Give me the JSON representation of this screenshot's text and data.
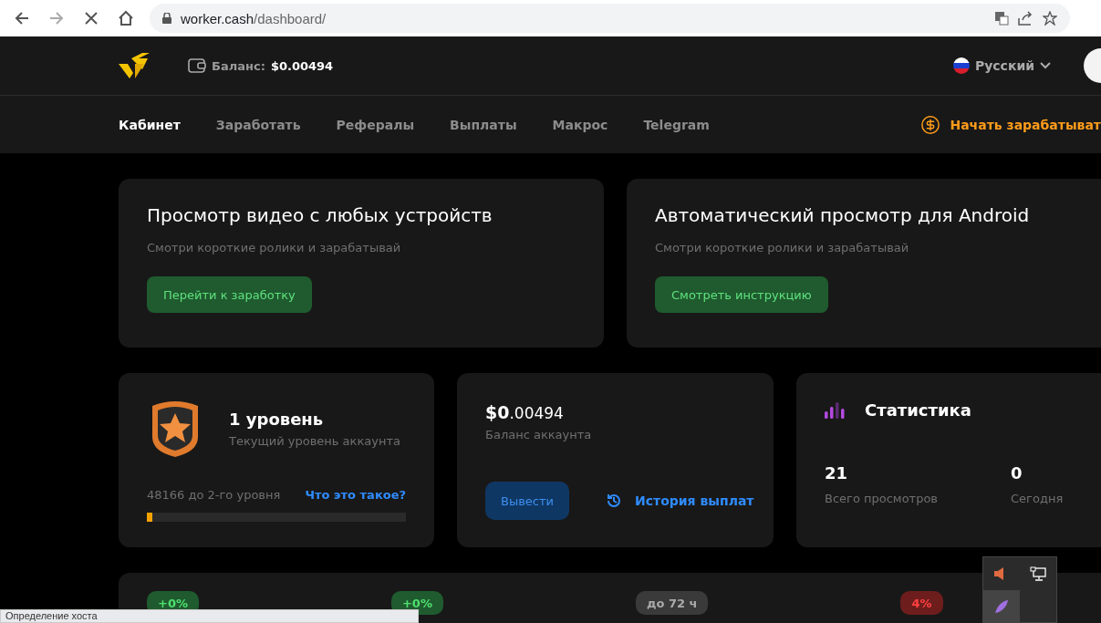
{
  "browser": {
    "url_host": "worker.cash",
    "url_path": "/dashboard/"
  },
  "header": {
    "balance_label": "Баланс:",
    "balance_value": "$0.00494",
    "language": "Русский"
  },
  "nav": {
    "items": [
      {
        "label": "Кабинет",
        "selected": true
      },
      {
        "label": "Заработать",
        "selected": false
      },
      {
        "label": "Рефералы",
        "selected": false
      },
      {
        "label": "Выплаты",
        "selected": false
      },
      {
        "label": "Макрос",
        "selected": false
      },
      {
        "label": "Telegram",
        "selected": false
      }
    ],
    "cta": "Начать зарабатыват"
  },
  "promo_cards": [
    {
      "title": "Просмотр видео с любых устройств",
      "subtitle": "Смотри короткие ролики и зарабатывай",
      "button": "Перейти к заработку"
    },
    {
      "title": "Автоматический просмотр для Android",
      "subtitle": "Смотри короткие ролики и зарабатывай",
      "button": "Смотреть инструкцию"
    }
  ],
  "level_card": {
    "title": "1 уровень",
    "subtitle": "Текущий уровень аккаунта",
    "progress_text": "48166 до 2-го уровня",
    "help_link": "Что это такое?",
    "level": 0.02
  },
  "balance_card": {
    "amount_whole": "$0",
    "amount_fraction": ".00494",
    "label": "Баланс аккаунта",
    "withdraw": "Вывести",
    "history": "История выплат"
  },
  "stats_card": {
    "title": "Статистика",
    "stats": [
      {
        "value": "21",
        "label": "Всего просмотров"
      },
      {
        "value": "0",
        "label": "Сегодня"
      }
    ]
  },
  "badges": [
    {
      "text": "+0%",
      "kind": "up"
    },
    {
      "text": "+0%",
      "kind": "up"
    },
    {
      "text": "до 72 ч",
      "kind": "neutral"
    },
    {
      "text": "4%",
      "kind": "down"
    }
  ],
  "status_bar": "Определение хоста"
}
